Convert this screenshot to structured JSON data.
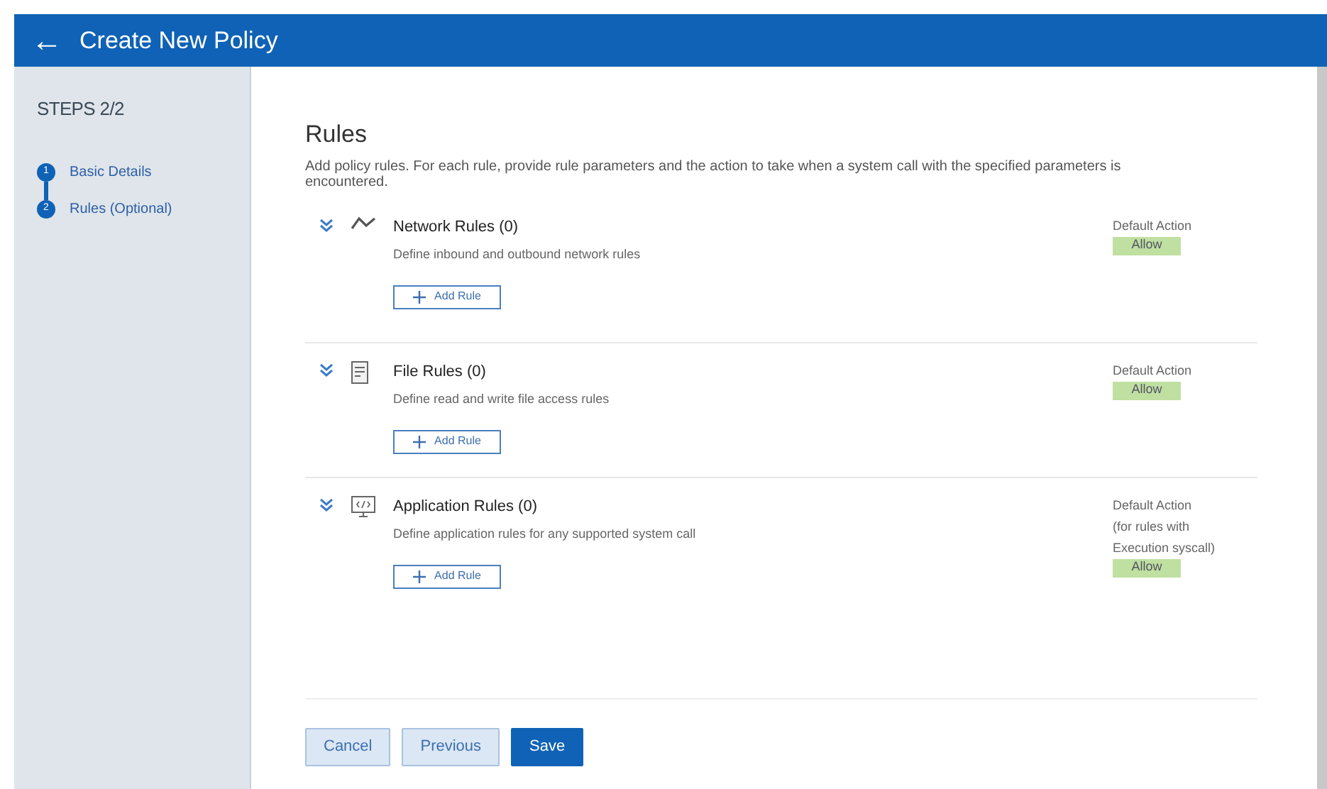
{
  "header": {
    "back": "←",
    "title": "Create New Policy"
  },
  "sidebar": {
    "steps_label": "STEPS 2/2",
    "steps": [
      {
        "number": "1",
        "label": "Basic Details"
      },
      {
        "number": "2",
        "label": "Rules (Optional)"
      }
    ]
  },
  "main": {
    "title": "Rules",
    "description": "Add policy rules. For each rule, provide rule parameters and the action to take when a system call with the specified parameters is encountered.",
    "sections": [
      {
        "kind": "network",
        "title": "Network Rules (0)",
        "description": "Define inbound and outbound network rules",
        "add_button": "Add Rule",
        "action_label": [
          "Default Action"
        ],
        "action": "Allow"
      },
      {
        "kind": "file",
        "title": "File Rules (0)",
        "description": "Define read and write file access rules",
        "add_button": "Add Rule",
        "action_label": [
          "Default Action"
        ],
        "action": "Allow"
      },
      {
        "kind": "application",
        "title": "Application Rules (0)",
        "description": "Define application rules for any supported system call",
        "add_button": "Add Rule",
        "action_label": [
          "Default Action",
          "(for rules with",
          "Execution syscall)"
        ],
        "action": "Allow"
      }
    ],
    "buttons": [
      {
        "kind": "secondary",
        "label": "Cancel"
      },
      {
        "kind": "secondary",
        "label": "Previous"
      },
      {
        "kind": "primary",
        "label": "Save"
      }
    ]
  }
}
